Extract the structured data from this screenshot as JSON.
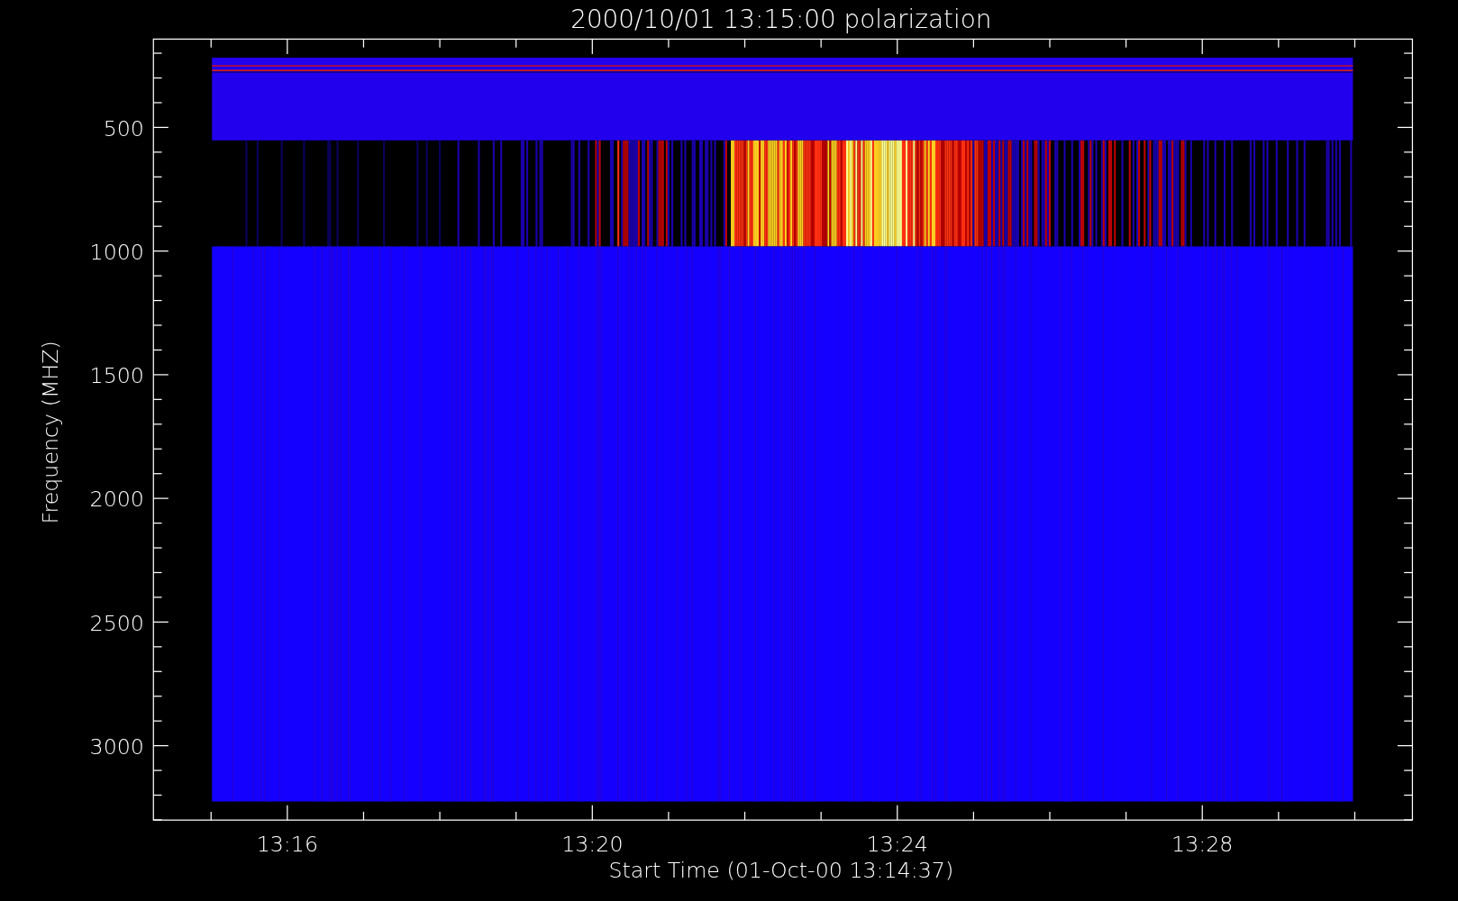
{
  "title": "2000/10/01 13:15:00 polarization",
  "y_axis": {
    "label": "Frequency (MHZ)",
    "ticks": [
      "500",
      "1000",
      "1500",
      "2000",
      "2500",
      "3000"
    ]
  },
  "x_axis": {
    "label": "Start Time (01-Oct-00 13:14:37)",
    "ticks": [
      "13:16",
      "13:20",
      "13:24",
      "13:28"
    ]
  }
}
